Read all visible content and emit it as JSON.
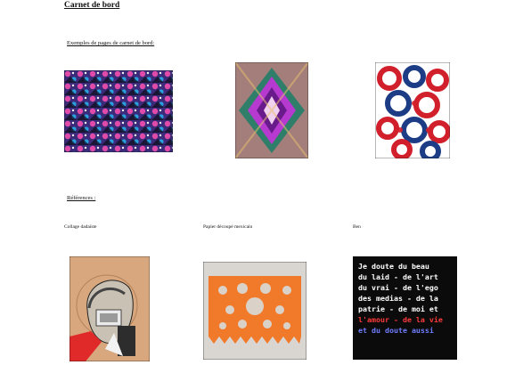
{
  "doc": {
    "title": "Carnet de bord",
    "section_examples": "Exemples de pages de carnet de bord:",
    "section_refs": "Références :"
  },
  "examples": [
    {
      "label": "",
      "icon": "pattern-collage-image"
    },
    {
      "label": "",
      "icon": "kaleidoscope-collage-image"
    },
    {
      "label": "",
      "icon": "abstract-circles-image"
    }
  ],
  "references": {
    "captions": [
      "Collage dadaïste",
      "Papier découpé mexicain",
      "Ben"
    ],
    "ben_text_lines": [
      "Je doute du beau",
      "du laid - de l'art",
      "du vrai - de l'ego",
      "des medias - de la",
      "patrie - de moi et",
      "l'amour - de la vie",
      "et du doute aussi"
    ]
  },
  "colors": {
    "papel_picado": "#f07a2a",
    "ben_background": "#0b0b0b",
    "ben_text": "#ffffff",
    "ben_accent_red": "#ff3a3a",
    "ben_accent_blue": "#6f7dff"
  }
}
